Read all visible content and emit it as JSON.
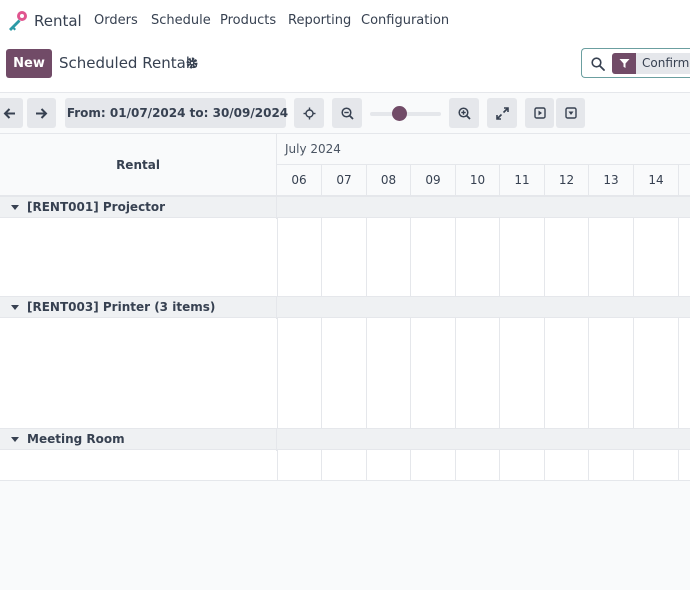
{
  "navbar": {
    "app_name": "Rental",
    "menu": [
      "Orders",
      "Schedule",
      "Products",
      "Reporting",
      "Configuration"
    ]
  },
  "control": {
    "new_label": "New",
    "breadcrumb": "Scheduled Rentals",
    "search_facet": "Confirmed"
  },
  "toolbar": {
    "range_label": "From: 01/07/2024 to: 30/09/2024"
  },
  "gantt": {
    "row_header": "Rental",
    "month": "July 2024",
    "days": [
      "06",
      "07",
      "08",
      "09",
      "10",
      "11",
      "12",
      "13",
      "14"
    ],
    "groups": [
      "[RENT001] Projector",
      "[RENT003] Printer (3 items)",
      "Meeting Room"
    ]
  },
  "colors": {
    "brand": "#714B67",
    "search_border": "#6b9fa0"
  }
}
